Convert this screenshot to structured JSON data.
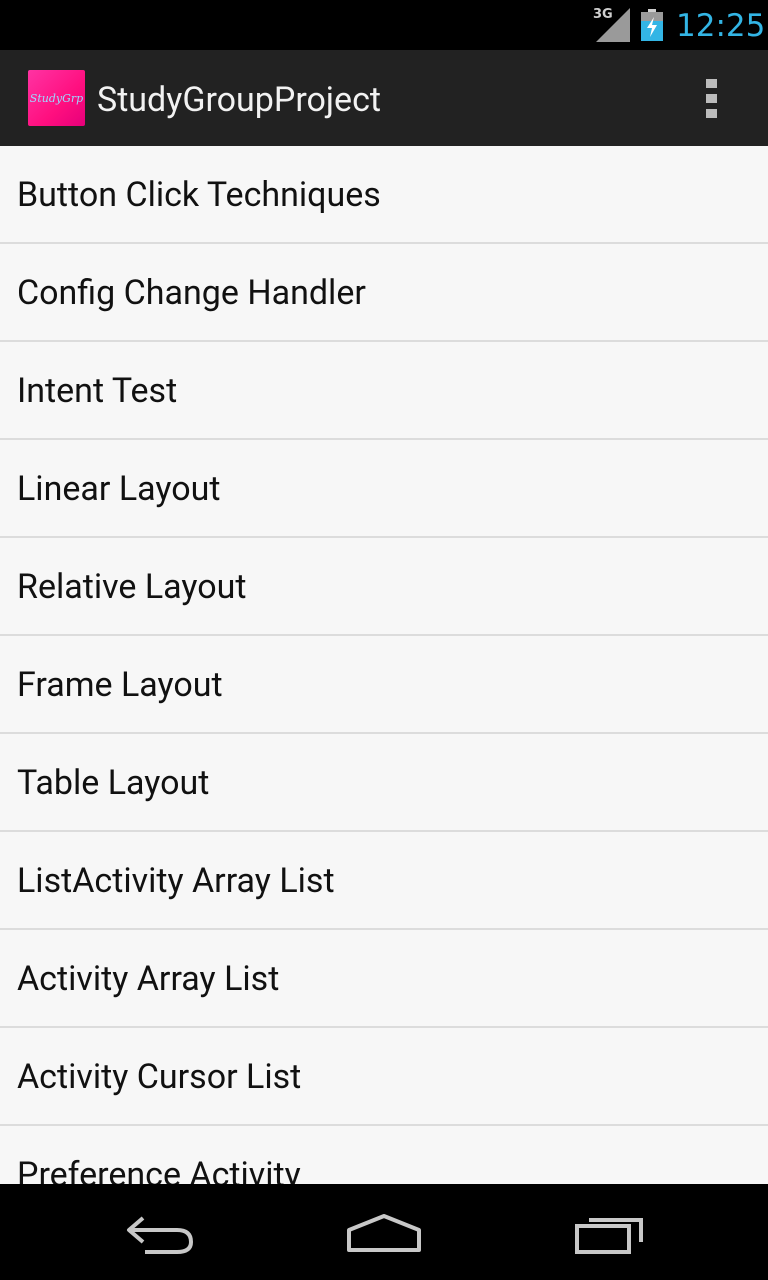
{
  "status_bar": {
    "network": "3G",
    "time": "12:25",
    "icons": [
      "signal-icon",
      "battery-charging-icon"
    ]
  },
  "action_bar": {
    "app_icon_text": "StudyGrp",
    "title": "StudyGroupProject",
    "overflow_icon": "overflow-menu-icon"
  },
  "list": {
    "items": [
      {
        "label": "Button Click Techniques"
      },
      {
        "label": "Config Change Handler"
      },
      {
        "label": "Intent Test"
      },
      {
        "label": "Linear Layout"
      },
      {
        "label": "Relative Layout"
      },
      {
        "label": "Frame Layout"
      },
      {
        "label": "Table Layout"
      },
      {
        "label": "ListActivity Array List"
      },
      {
        "label": "Activity Array List"
      },
      {
        "label": "Activity Cursor List"
      },
      {
        "label": "Preference Activity"
      }
    ]
  },
  "nav_bar": {
    "icons": [
      "back-icon",
      "home-icon",
      "recent-apps-icon"
    ]
  },
  "colors": {
    "accent": "#33b5e5",
    "action_bar": "#222222",
    "app_icon": "#ff0f7f",
    "list_background": "#f7f7f7",
    "divider": "#dcdcdc"
  }
}
